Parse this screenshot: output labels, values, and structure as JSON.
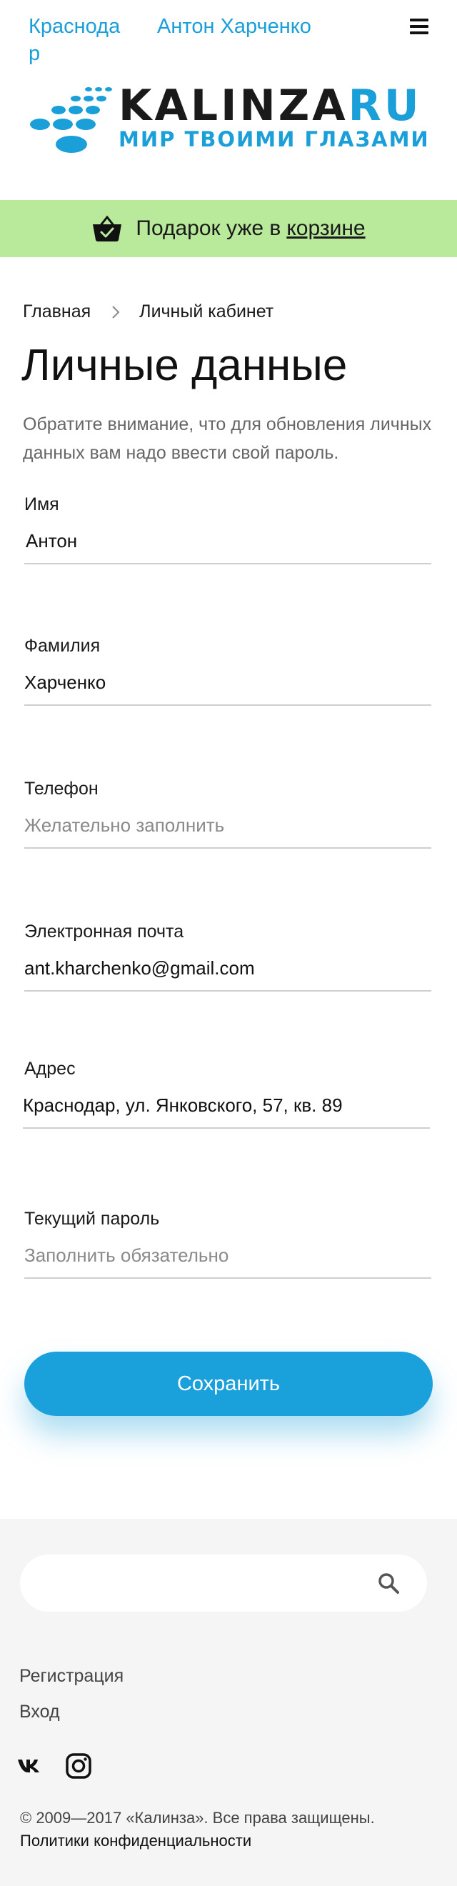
{
  "header": {
    "city": "Краснодар",
    "user_name": "Антон Харченко",
    "menu_icon": "hamburger-icon",
    "logo": {
      "name": "KALINZA",
      "suffix": "RU",
      "tagline": "МИР ТВОИМИ ГЛАЗАМИ"
    }
  },
  "gift_banner": {
    "icon": "basket-check-icon",
    "text": "Подарок уже в",
    "link": "корзине"
  },
  "breadcrumb": {
    "home": "Главная",
    "separator_icon": "chevron-right-icon",
    "current": "Личный кабинет"
  },
  "page": {
    "title": "Личные данные",
    "notice": "Обратите внимание, что для обновления личных данных вам надо ввести свой пароль."
  },
  "form": {
    "first_name": {
      "label": "Имя",
      "value": "Антон",
      "placeholder": ""
    },
    "last_name": {
      "label": "Фамилия",
      "value": "Харченко",
      "placeholder": ""
    },
    "phone": {
      "label": "Телефон",
      "value": "",
      "placeholder": "Желательно заполнить"
    },
    "email": {
      "label": "Электронная почта",
      "value": "ant.kharchenko@gmail.com",
      "placeholder": ""
    },
    "address": {
      "label": "Адрес",
      "value": "Краснодар, ул. Янковского, 57, кв. 89",
      "placeholder": ""
    },
    "password": {
      "label": "Текущий пароль",
      "value": "",
      "placeholder": "Заполнить обязательно"
    },
    "save_label": "Сохранить"
  },
  "footer": {
    "search": {
      "placeholder": "",
      "icon": "search-icon"
    },
    "links": {
      "register": "Регистрация",
      "login": "Вход"
    },
    "social": [
      "vk-icon",
      "instagram-icon"
    ],
    "copyright": "© 2009—2017 «Калинза». Все права защищены.",
    "privacy": "Политики конфиденциальности"
  },
  "colors": {
    "accent": "#1aa0db",
    "banner": "#b9e99b",
    "footer_bg": "#f5f5f5"
  }
}
